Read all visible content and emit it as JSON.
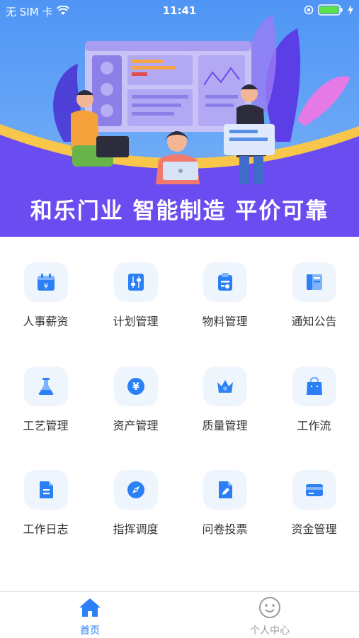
{
  "status_bar": {
    "carrier": "无 SIM 卡",
    "time": "11:41"
  },
  "banner": {
    "slogan": "和乐门业  智能制造  平价可靠"
  },
  "colors": {
    "accent": "#2c80f6",
    "banner_purple": "#6a4cf0",
    "tile_bg": "#eef5fd",
    "battery": "#5ee14b",
    "tab_inactive": "#9a9a9a"
  },
  "modules": [
    {
      "label": "人事薪资",
      "icon": "calendar-yen-icon"
    },
    {
      "label": "计划管理",
      "icon": "sliders-icon"
    },
    {
      "label": "物料管理",
      "icon": "clipboard-icon"
    },
    {
      "label": "通知公告",
      "icon": "notice-icon"
    },
    {
      "label": "工艺管理",
      "icon": "flask-icon"
    },
    {
      "label": "资产管理",
      "icon": "yen-coin-icon"
    },
    {
      "label": "质量管理",
      "icon": "crown-icon"
    },
    {
      "label": "工作流",
      "icon": "shopping-bag-icon"
    },
    {
      "label": "工作日志",
      "icon": "document-icon"
    },
    {
      "label": "指挥调度",
      "icon": "compass-icon"
    },
    {
      "label": "问卷投票",
      "icon": "edit-document-icon"
    },
    {
      "label": "资金管理",
      "icon": "card-icon"
    }
  ],
  "tabbar": {
    "home_label": "首页",
    "profile_label": "个人中心"
  }
}
